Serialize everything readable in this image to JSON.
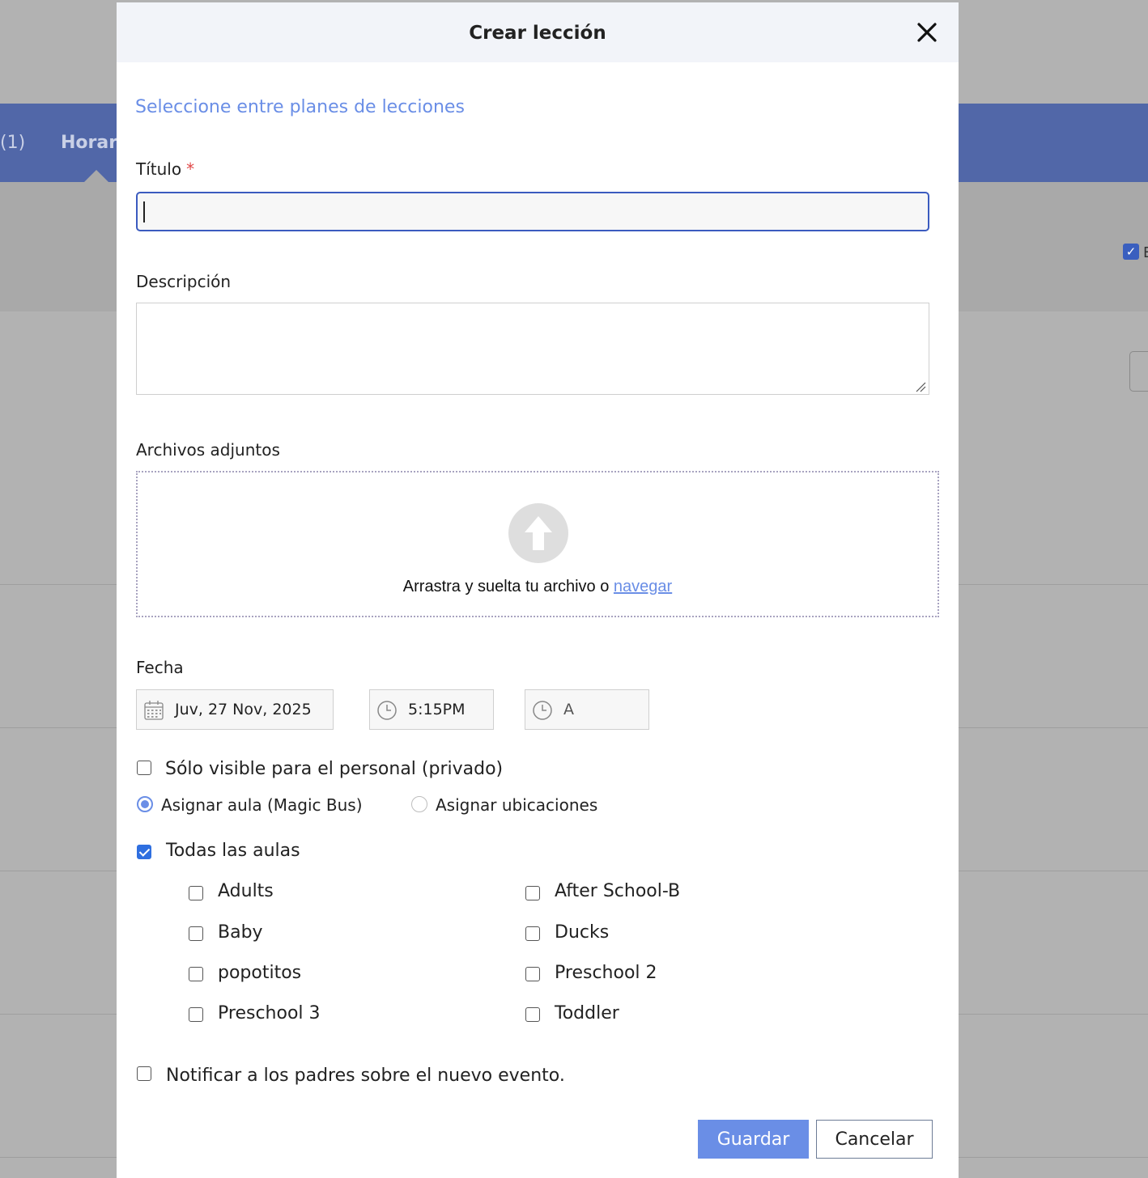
{
  "background": {
    "tab_count": "(1)",
    "tab_label": "Horar"
  },
  "modal": {
    "title": "Crear lección",
    "select_plans_link": "Seleccione entre planes de lecciones",
    "title_label": "Título",
    "required_mark": "*",
    "title_value": "",
    "description_label": "Descripción",
    "description_value": "",
    "attachments_label": "Archivos adjuntos",
    "drop_text": "Arrastra y suelta tu archivo o",
    "browse_link": "navegar",
    "date_label": "Fecha",
    "date_value": "Juv, 27 Nov, 2025",
    "start_time": "5:15PM",
    "end_time_placeholder": "A",
    "private_label": "Sólo visible para el personal (privado)",
    "private_checked": false,
    "assign_classroom_label": "Asignar aula (Magic Bus)",
    "assign_locations_label": "Asignar ubicaciones",
    "assign_selected": "classroom",
    "all_classrooms_label": "Todas las aulas",
    "all_classrooms_checked": true,
    "classrooms": [
      {
        "label": "Adults",
        "checked": false
      },
      {
        "label": "After School-B",
        "checked": false
      },
      {
        "label": "Baby",
        "checked": false
      },
      {
        "label": "Ducks",
        "checked": false
      },
      {
        "label": "popotitos",
        "checked": false
      },
      {
        "label": "Preschool 2",
        "checked": false
      },
      {
        "label": "Preschool 3",
        "checked": false
      },
      {
        "label": "Toddler",
        "checked": false
      }
    ],
    "notify_label": "Notificar a los padres sobre el nuevo evento.",
    "notify_checked": false,
    "save_label": "Guardar",
    "cancel_label": "Cancelar"
  },
  "colors": {
    "accent": "#6a8ee6",
    "header_band": "#5167a8",
    "checkbox_checked": "#2f6fe0",
    "required": "#e04848"
  }
}
